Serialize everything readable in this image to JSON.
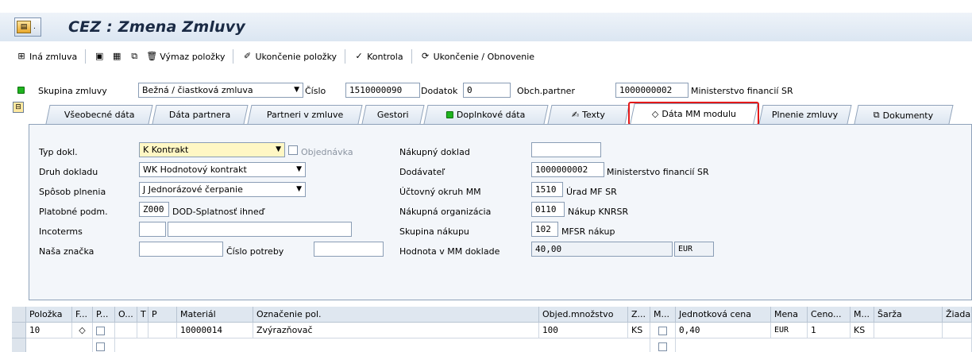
{
  "title": "CEZ : Zmena Zmluvy",
  "app_icon": "transaction-icon",
  "toolbar": {
    "other_contract": "Iná zmluva",
    "delete_item": "Výmaz položky",
    "finish_item": "Ukončenie položky",
    "check": "Kontrola",
    "finish_renew": "Ukončenie / Obnovenie"
  },
  "header": {
    "group_label": "Skupina zmluvy",
    "group_value": "Bežná / čiastková zmluva",
    "number_label": "Číslo",
    "number_value": "1510000090",
    "addendum_label": "Dodatok",
    "addendum_value": "0",
    "partner_label": "Obch.partner",
    "partner_value": "1000000002",
    "partner_name": "Ministerstvo financií SR"
  },
  "tabs": [
    {
      "label": "Všeobecné dáta"
    },
    {
      "label": "Dáta partnera"
    },
    {
      "label": "Partneri v zmluve"
    },
    {
      "label": "Gestori"
    },
    {
      "label": "Doplnkové dáta"
    },
    {
      "label": "Texty"
    },
    {
      "label": "Dáta MM modulu"
    },
    {
      "label": "Plnenie zmluvy"
    },
    {
      "label": "Dokumenty"
    }
  ],
  "form": {
    "doc_type_label": "Typ dokl.",
    "doc_type_value": "K Kontrakt",
    "order_label": "Objednávka",
    "doc_kind_label": "Druh dokladu",
    "doc_kind_value": "WK Hodnotový kontrakt",
    "fulfil_label": "Spôsob plnenia",
    "fulfil_value": "J Jednorázové čerpanie",
    "pay_label": "Platobné podm.",
    "pay_code": "Z000",
    "pay_text": "DOD-Splatnosť ihneď",
    "incoterms_label": "Incoterms",
    "our_ref_label": "Naša značka",
    "need_no_label": "Číslo potreby",
    "purchase_doc_label": "Nákupný doklad",
    "supplier_label": "Dodávateľ",
    "supplier_value": "1000000002",
    "supplier_name": "Ministerstvo financií SR",
    "company_label": "Účtovný okruh MM",
    "company_value": "1510",
    "company_name": "Úrad MF SR",
    "porg_label": "Nákupná organizácia",
    "porg_value": "0110",
    "porg_name": "Nákup KNRSR",
    "pgroup_label": "Skupina nákupu",
    "pgroup_value": "102",
    "pgroup_name": "MFSR nákup",
    "mm_value_label": "Hodnota v MM doklade",
    "mm_value": "40,00",
    "mm_currency": "EUR"
  },
  "table": {
    "headers": [
      "Položka",
      "F...",
      "P...",
      "O...",
      "T",
      "P",
      "Materiál",
      "Označenie pol.",
      "Objed.množstvo",
      "Z...",
      "M...",
      "Jednotková cena",
      "Mena",
      "Ceno...",
      "M...",
      "Šarža",
      "Žiada"
    ],
    "row": {
      "item": "10",
      "material": "10000014",
      "description": "Zvýrazňovač",
      "qty": "100",
      "unit": "KS",
      "price": "0,40",
      "currency": "EUR",
      "price_unit": "1",
      "unit2": "KS"
    }
  }
}
